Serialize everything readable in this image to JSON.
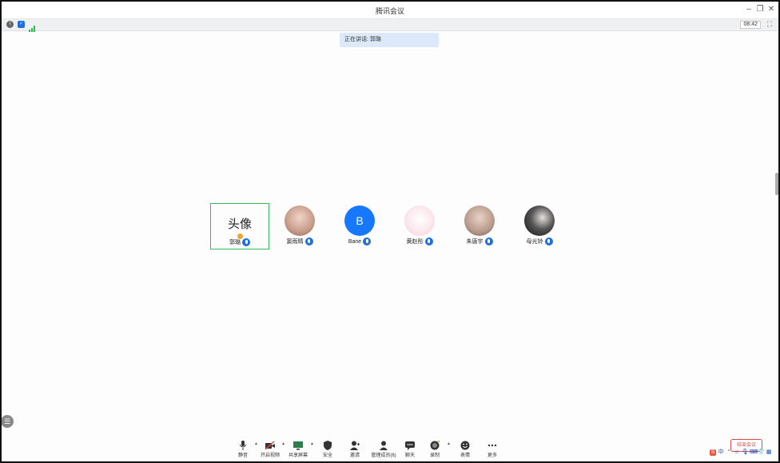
{
  "window": {
    "title": "腾讯会议"
  },
  "status": {
    "clock": "08:42"
  },
  "banner": {
    "speaking_text": "正在讲话: 郭璐"
  },
  "participants": [
    {
      "name": "郭璐",
      "avatar_text": "头像",
      "active": true,
      "color": "#ffffff"
    },
    {
      "name": "窦雨晴",
      "avatar_text": "",
      "active": false,
      "color": "#d7b7a8"
    },
    {
      "name": "Bane",
      "avatar_text": "B",
      "active": false,
      "color": "#1677ff"
    },
    {
      "name": "黄赵彤",
      "avatar_text": "",
      "active": false,
      "color": "#f4d9df"
    },
    {
      "name": "朱唐宇",
      "avatar_text": "",
      "active": false,
      "color": "#c7b2a8"
    },
    {
      "name": "母光铃",
      "avatar_text": "",
      "active": false,
      "color": "#2a2a2a"
    }
  ],
  "toolbar": {
    "mute": "静音",
    "video": "开启视频",
    "share": "共享屏幕",
    "security": "安全",
    "invite": "邀请",
    "members": "管理成员(6)",
    "chat": "聊天",
    "record": "录制",
    "reactions": "表情",
    "more": "更多",
    "end": "结束会议"
  },
  "tray": {
    "ime_label": "中"
  }
}
